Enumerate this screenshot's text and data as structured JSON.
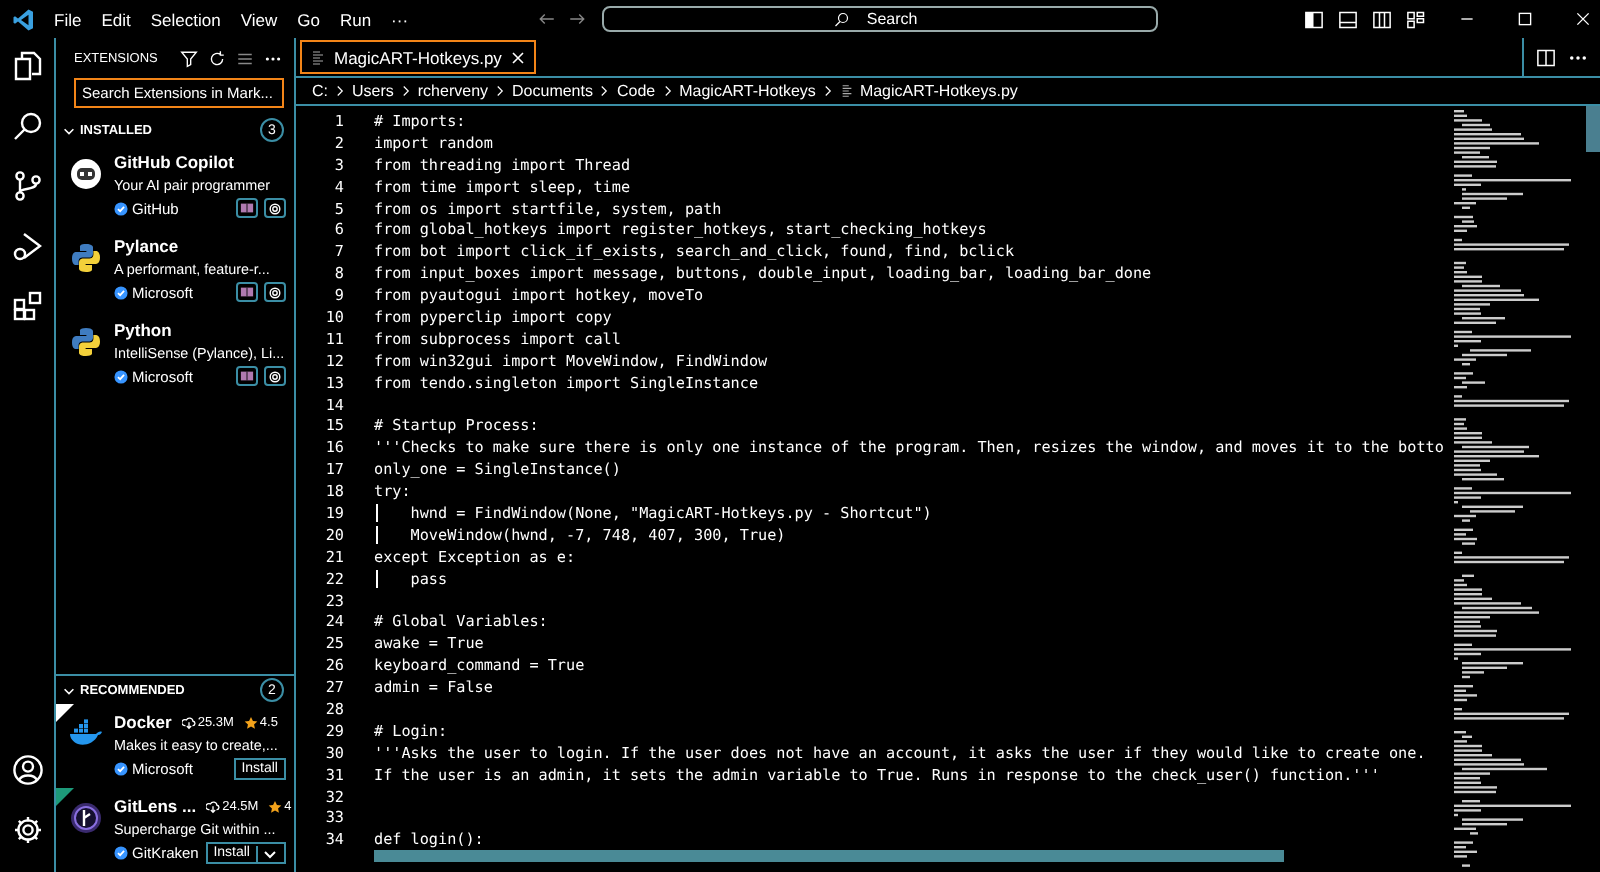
{
  "menu_bar": {
    "items": [
      "File",
      "Edit",
      "Selection",
      "View",
      "Go",
      "Run",
      "···"
    ],
    "search": {
      "placeholder": "Search"
    }
  },
  "sidebar": {
    "title": "EXTENSIONS",
    "search": {
      "placeholder": "Search Extensions in Mark..."
    },
    "sections": [
      {
        "title": "INSTALLED",
        "count": "3",
        "expanded": true,
        "items": [
          {
            "kind": "installed",
            "name": "GitHub Copilot",
            "description": "Your AI pair programmer",
            "publisher": "GitHub",
            "verified": true
          },
          {
            "kind": "installed",
            "name": "Pylance",
            "description": "A performant, feature-r...",
            "publisher": "Microsoft",
            "verified": true
          },
          {
            "kind": "installed",
            "name": "Python",
            "description": "IntelliSense (Pylance), Li...",
            "publisher": "Microsoft",
            "verified": true
          }
        ]
      },
      {
        "title": "RECOMMENDED",
        "count": "2",
        "expanded": true,
        "items": [
          {
            "kind": "recommended",
            "color": "#ffffff",
            "name": "Docker",
            "downloads": "25.3M",
            "rating": "4.5",
            "description": "Makes it easy to create,...",
            "publisher": "Microsoft",
            "verified": true,
            "action": "Install",
            "dropdown": false
          },
          {
            "kind": "recommended",
            "color": "#1d9a7a",
            "name": "GitLens ...",
            "downloads": "24.5M",
            "rating": "4",
            "description": "Supercharge Git within ...",
            "publisher": "GitKraken",
            "verified": true,
            "action": "Install",
            "dropdown": true
          }
        ]
      }
    ]
  },
  "editor": {
    "tabs": [
      {
        "label": "MagicART-Hotkeys.py",
        "selected": true
      }
    ],
    "breadcrumb": [
      "C:",
      "Users",
      "rcherveny",
      "Documents",
      "Code",
      "MagicART-Hotkeys",
      "MagicART-Hotkeys.py"
    ],
    "lines": [
      {
        "number": "1",
        "text": "# Imports:"
      },
      {
        "number": "2",
        "text": "import random"
      },
      {
        "number": "3",
        "text": "from threading import Thread"
      },
      {
        "number": "4",
        "text": "from time import sleep, time"
      },
      {
        "number": "5",
        "text": "from os import startfile, system, path"
      },
      {
        "number": "6",
        "text": "from global_hotkeys import register_hotkeys, start_checking_hotkeys"
      },
      {
        "number": "7",
        "text": "from bot import click_if_exists, search_and_click, found, find, bclick"
      },
      {
        "number": "8",
        "text": "from input_boxes import message, buttons, double_input, loading_bar, loading_bar_done"
      },
      {
        "number": "9",
        "text": "from pyautogui import hotkey, moveTo"
      },
      {
        "number": "10",
        "text": "from pyperclip import copy"
      },
      {
        "number": "11",
        "text": "from subprocess import call"
      },
      {
        "number": "12",
        "text": "from win32gui import MoveWindow, FindWindow"
      },
      {
        "number": "13",
        "text": "from tendo.singleton import SingleInstance"
      },
      {
        "number": "14"
      },
      {
        "number": "15",
        "text": "# Startup Process:"
      },
      {
        "number": "16",
        "text": "'''Checks to make sure there is only one instance of the program. Then, resizes the window, and moves it to the botto"
      },
      {
        "number": "17",
        "text": "only_one = SingleInstance()"
      },
      {
        "number": "18",
        "text": "try:"
      },
      {
        "number": "19",
        "text": "    hwnd = FindWindow(None, \"MagicART-Hotkeys.py - Shortcut\")"
      },
      {
        "number": "20",
        "text": "    MoveWindow(hwnd, -7, 748, 407, 300, True)"
      },
      {
        "number": "21",
        "text": "except Exception as e:"
      },
      {
        "number": "22",
        "text": "    pass"
      },
      {
        "number": "23"
      },
      {
        "number": "24",
        "text": "# Global Variables:"
      },
      {
        "number": "25",
        "text": "awake = True"
      },
      {
        "number": "26",
        "text": "keyboard_command = True"
      },
      {
        "number": "27",
        "text": "admin = False"
      },
      {
        "number": "28"
      },
      {
        "number": "29",
        "text": "# Login:"
      },
      {
        "number": "30",
        "text": "'''Asks the user to login. If the user does not have an account, it asks the user if they would like to create one."
      },
      {
        "number": "31",
        "text": "If the user is an admin, it sets the admin variable to True. Runs in response to the check_user() function.'''"
      },
      {
        "number": "32"
      },
      {
        "number": "33"
      },
      {
        "number": "34",
        "text": "def login():"
      }
    ]
  }
}
